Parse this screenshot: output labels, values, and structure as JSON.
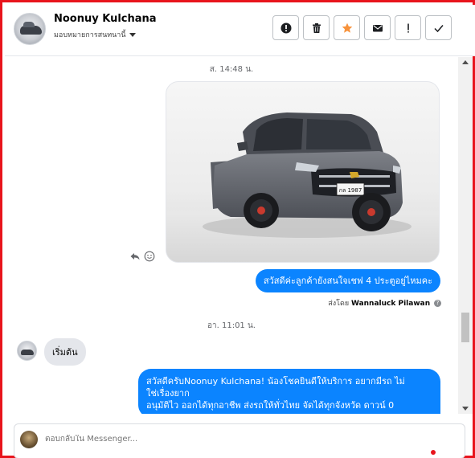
{
  "header": {
    "name": "Noonuy Kulchana",
    "subtitle": "มอบหมายการสนทนานี้",
    "actions": [
      "exclamation-circle-icon",
      "trash-icon",
      "star-icon",
      "envelope-icon",
      "exclamation-icon",
      "check-icon"
    ],
    "star_color": "#f7923b"
  },
  "thread": {
    "timestamp_1": "ส. 14:48 น.",
    "outgoing_1": "สวัสดีค่ะลูกค้ายังสนใจเชฟ 4 ประตูอยู่ไหมคะ",
    "sent_by_prefix": "ส่งโดย",
    "sent_by_name": "Wannaluck Pilawan",
    "timestamp_2": "อา. 11:01 น.",
    "incoming_1": "เริ่มต้น",
    "outgoing_2_line1": "สวัสดีครับNoonuy Kulchana! น้องโชคยินดีให้บริการ อยากมีรถ ไม่",
    "outgoing_2_line2": "ใช่เรื่องยาก",
    "outgoing_2_line3": "อนุมัติไว ออกได้ทุกอาชีพ ส่งรถให้ทั่วไทย จัดได้ทุกจังหวัด ดาวน์ 0",
    "plate_text": "กล 1987",
    "bubble_color": "#0b84ff"
  },
  "composer": {
    "placeholder": "ตอบกลับใน Messenger..."
  }
}
